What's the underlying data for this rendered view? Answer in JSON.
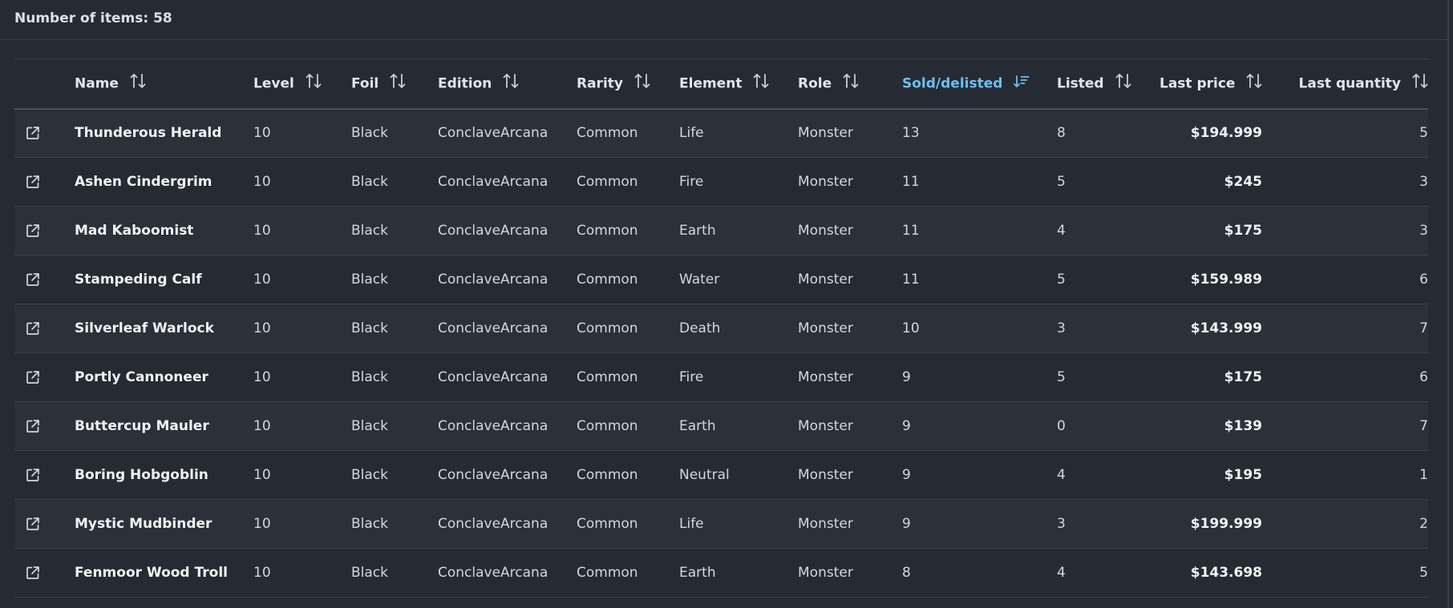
{
  "header": {
    "item_count_label": "Number of items: 58"
  },
  "columns": {
    "name": "Name",
    "level": "Level",
    "foil": "Foil",
    "edition": "Edition",
    "rarity": "Rarity",
    "element": "Element",
    "role": "Role",
    "sold": "Sold/delisted",
    "listed": "Listed",
    "last_price": "Last price",
    "last_quantity": "Last quantity"
  },
  "sort": {
    "active_column": "sold",
    "direction": "descending"
  },
  "icons": {
    "sort": "sort-arrows-icon",
    "active_sort": "sort-descending-icon",
    "row_link": "external-link-icon"
  },
  "colors": {
    "background": "#262b33",
    "row_alt": "#2b3039",
    "active": "#6cc0f5"
  },
  "rows": [
    {
      "name": "Thunderous Herald",
      "level": "10",
      "foil": "Black",
      "edition": "ConclaveArcana",
      "rarity": "Common",
      "element": "Life",
      "role": "Monster",
      "sold": "13",
      "listed": "8",
      "last_price": "$194.999",
      "last_quantity": "5"
    },
    {
      "name": "Ashen Cindergrim",
      "level": "10",
      "foil": "Black",
      "edition": "ConclaveArcana",
      "rarity": "Common",
      "element": "Fire",
      "role": "Monster",
      "sold": "11",
      "listed": "5",
      "last_price": "$245",
      "last_quantity": "3"
    },
    {
      "name": "Mad Kaboomist",
      "level": "10",
      "foil": "Black",
      "edition": "ConclaveArcana",
      "rarity": "Common",
      "element": "Earth",
      "role": "Monster",
      "sold": "11",
      "listed": "4",
      "last_price": "$175",
      "last_quantity": "3"
    },
    {
      "name": "Stampeding Calf",
      "level": "10",
      "foil": "Black",
      "edition": "ConclaveArcana",
      "rarity": "Common",
      "element": "Water",
      "role": "Monster",
      "sold": "11",
      "listed": "5",
      "last_price": "$159.989",
      "last_quantity": "6"
    },
    {
      "name": "Silverleaf Warlock",
      "level": "10",
      "foil": "Black",
      "edition": "ConclaveArcana",
      "rarity": "Common",
      "element": "Death",
      "role": "Monster",
      "sold": "10",
      "listed": "3",
      "last_price": "$143.999",
      "last_quantity": "7"
    },
    {
      "name": "Portly Cannoneer",
      "level": "10",
      "foil": "Black",
      "edition": "ConclaveArcana",
      "rarity": "Common",
      "element": "Fire",
      "role": "Monster",
      "sold": "9",
      "listed": "5",
      "last_price": "$175",
      "last_quantity": "6"
    },
    {
      "name": "Buttercup Mauler",
      "level": "10",
      "foil": "Black",
      "edition": "ConclaveArcana",
      "rarity": "Common",
      "element": "Earth",
      "role": "Monster",
      "sold": "9",
      "listed": "0",
      "last_price": "$139",
      "last_quantity": "7"
    },
    {
      "name": "Boring Hobgoblin",
      "level": "10",
      "foil": "Black",
      "edition": "ConclaveArcana",
      "rarity": "Common",
      "element": "Neutral",
      "role": "Monster",
      "sold": "9",
      "listed": "4",
      "last_price": "$195",
      "last_quantity": "1"
    },
    {
      "name": "Mystic Mudbinder",
      "level": "10",
      "foil": "Black",
      "edition": "ConclaveArcana",
      "rarity": "Common",
      "element": "Life",
      "role": "Monster",
      "sold": "9",
      "listed": "3",
      "last_price": "$199.999",
      "last_quantity": "2"
    },
    {
      "name": "Fenmoor Wood Troll",
      "level": "10",
      "foil": "Black",
      "edition": "ConclaveArcana",
      "rarity": "Common",
      "element": "Earth",
      "role": "Monster",
      "sold": "8",
      "listed": "4",
      "last_price": "$143.698",
      "last_quantity": "5"
    }
  ]
}
